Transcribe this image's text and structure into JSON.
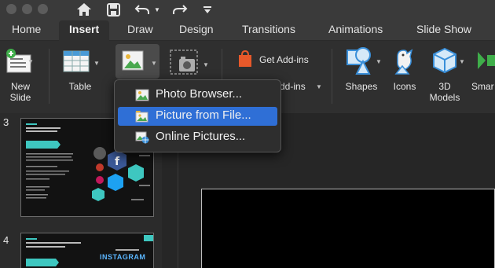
{
  "quick_access": {
    "icons": [
      "home-icon",
      "save-icon",
      "undo-icon",
      "redo-icon",
      "customize-icon"
    ]
  },
  "tabs": [
    {
      "label": "Home"
    },
    {
      "label": "Insert"
    },
    {
      "label": "Draw"
    },
    {
      "label": "Design"
    },
    {
      "label": "Transitions"
    },
    {
      "label": "Animations"
    },
    {
      "label": "Slide Show"
    }
  ],
  "active_tab": "Insert",
  "ribbon": {
    "new_slide": "New\nSlide",
    "table": "Table",
    "get_addins": "Get Add-ins",
    "my_addins": "Add-ins",
    "shapes": "Shapes",
    "icons": "Icons",
    "models_3d": "3D\nModels",
    "smartart": "Smar"
  },
  "picture_menu": {
    "items": [
      {
        "label": "Photo Browser...",
        "icon": "photo-browser-icon",
        "selected": false
      },
      {
        "label": "Picture from File...",
        "icon": "picture-from-file-icon",
        "selected": true
      },
      {
        "label": "Online Pictures...",
        "icon": "online-pictures-icon",
        "selected": false
      }
    ]
  },
  "slides": [
    {
      "number": "3"
    },
    {
      "number": "4",
      "title_line": "INSTAGRAM"
    }
  ],
  "colors": {
    "accent_selected": "#2f6fd6",
    "addins_orange": "#e8592a",
    "teal": "#3ec7c0"
  }
}
